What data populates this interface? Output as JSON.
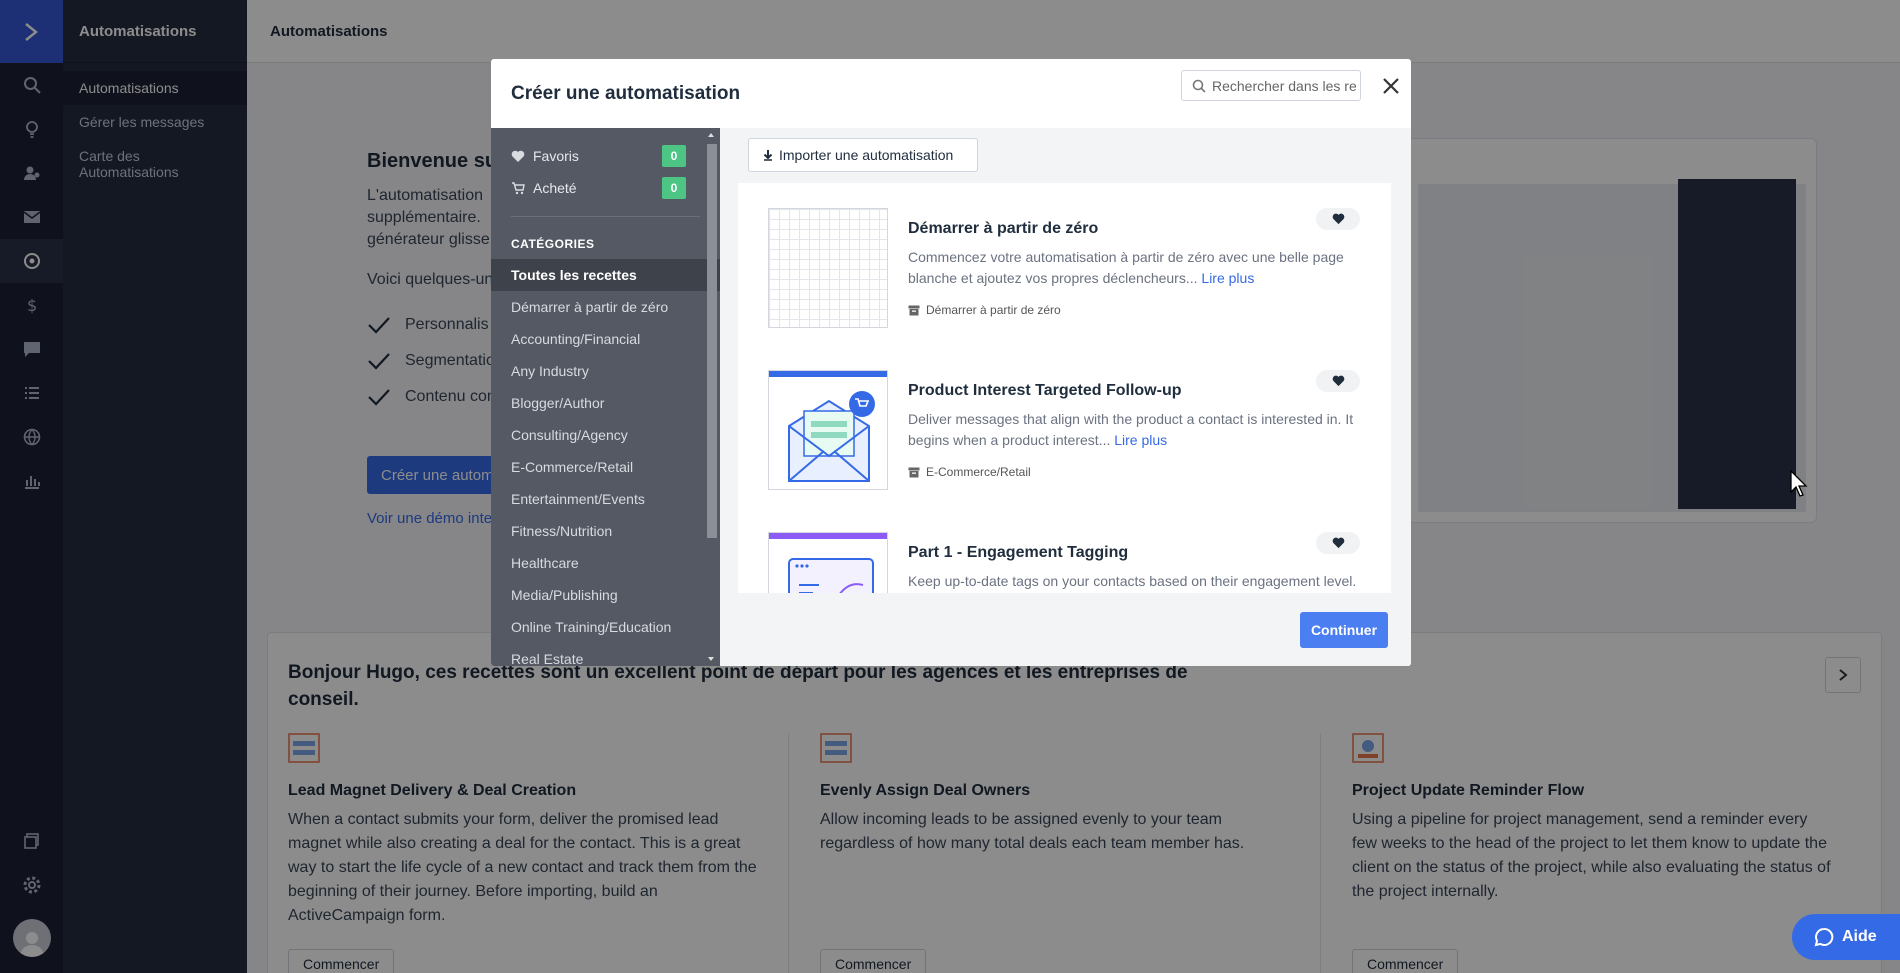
{
  "nav": {
    "section_title": "Automatisations",
    "items": [
      {
        "label": "Automatisations"
      },
      {
        "label": "Gérer les messages"
      },
      {
        "label": "Carte des Automatisations"
      }
    ]
  },
  "header": {
    "title": "Automatisations"
  },
  "welcome": {
    "title": "Bienvenue su",
    "text_line1": "L'automatisation",
    "text_line2": "supplémentaire.",
    "text_line3": "générateur glisse",
    "list_intro": "Voici quelques-un",
    "checks": [
      {
        "label": "Personnalis"
      },
      {
        "label": "Segmentatio"
      },
      {
        "label": "Contenu con"
      }
    ],
    "create_button": "Créer une automa",
    "demo_link": "Voir une démo inter"
  },
  "recipes": {
    "heading": "Bonjour Hugo, ces recettes sont un excellent point de départ pour les agences et les entreprises de conseil.",
    "cards": [
      {
        "title": "Lead Magnet Delivery & Deal Creation",
        "description": "When a contact submits your form, deliver the promised lead magnet while also creating a deal for the contact. This is a great way to start the life cycle of a new contact and track them from the beginning of their journey. Before importing, build an ActiveCampaign form.",
        "button": "Commencer"
      },
      {
        "title": "Evenly Assign Deal Owners",
        "description": "Allow incoming leads to be assigned evenly to your team regardless of how many total deals each team member has.",
        "button": "Commencer"
      },
      {
        "title": "Project Update Reminder Flow",
        "description": "Using a pipeline for project management, send a reminder every few weeks to the head of the project to let them know to update the client on the status of the project, while also evaluating the status of the project internally.",
        "button": "Commencer"
      }
    ]
  },
  "help": {
    "label": "Aide"
  },
  "modal": {
    "title": "Créer une automatisation",
    "search_placeholder": "Rechercher dans les re",
    "favorites": {
      "label": "Favoris",
      "count": "0"
    },
    "purchased": {
      "label": "Acheté",
      "count": "0"
    },
    "categories_heading": "CATÉGORIES",
    "categories": [
      {
        "label": "Toutes les recettes"
      },
      {
        "label": "Démarrer à partir de zéro"
      },
      {
        "label": "Accounting/Financial"
      },
      {
        "label": "Any Industry"
      },
      {
        "label": "Blogger/Author"
      },
      {
        "label": "Consulting/Agency"
      },
      {
        "label": "E-Commerce/Retail"
      },
      {
        "label": "Entertainment/Events"
      },
      {
        "label": "Fitness/Nutrition"
      },
      {
        "label": "Healthcare"
      },
      {
        "label": "Media/Publishing"
      },
      {
        "label": "Online Training/Education"
      },
      {
        "label": "Real Estate"
      }
    ],
    "import_button": "Importer une automatisation",
    "templates": [
      {
        "title": "Démarrer à partir de zéro",
        "description": "Commencez votre automatisation à partir de zéro avec une belle page blanche et ajoutez vos propres déclencheurs...",
        "more": "Lire plus",
        "category": "Démarrer à partir de zéro"
      },
      {
        "title": "Product Interest Targeted Follow-up",
        "description": "Deliver messages that align with the product a contact is interested in. It begins when a product interest...",
        "more": "Lire plus",
        "category": "E-Commerce/Retail"
      },
      {
        "title": "Part 1 - Engagement Tagging",
        "description": "Keep up-to-date tags on your contacts based on their engagement level.",
        "more": "",
        "category": ""
      }
    ],
    "continue_button": "Continuer"
  },
  "colors": {
    "accent": "#356ae6",
    "rail": "#1c2235",
    "badge": "#4cc585"
  }
}
